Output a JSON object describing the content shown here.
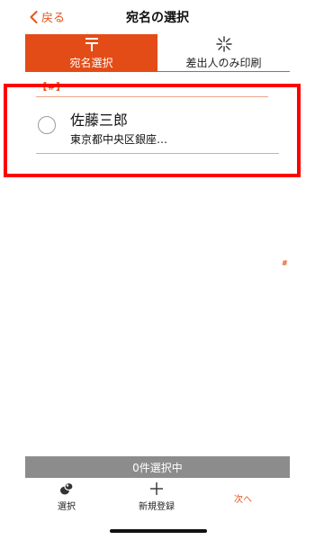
{
  "header": {
    "back_label": "戻る",
    "title": "宛名の選択"
  },
  "tabs": [
    {
      "label": "宛名選択",
      "icon": "postal-mark-icon",
      "active": true
    },
    {
      "label": "差出人のみ印刷",
      "icon": "sparkle-icon",
      "active": false
    }
  ],
  "list": {
    "section_label": "【#】",
    "items": [
      {
        "name": "佐藤三郎",
        "address": "東京都中央区銀座…",
        "selected": false
      }
    ]
  },
  "side_index_label": "#",
  "footer": {
    "selection_count": "0件選択中",
    "tools": [
      {
        "label": "選択",
        "icon": "select-icon"
      },
      {
        "label": "新規登録",
        "icon": "plus-icon"
      },
      {
        "label": "次へ",
        "icon": ""
      }
    ]
  },
  "colors": {
    "accent": "#e34c17",
    "highlight": "#ff0000",
    "count_bar": "#8c8c8c"
  }
}
